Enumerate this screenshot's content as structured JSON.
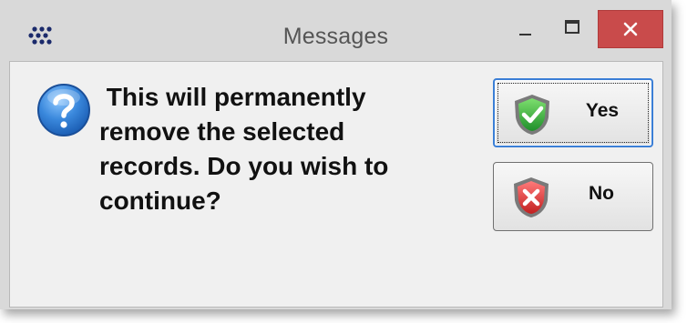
{
  "window": {
    "title": "Messages",
    "app_icon": "app-dots-icon",
    "controls": {
      "minimize_icon": "minimize-icon",
      "maximize_icon": "maximize-icon",
      "close_icon": "close-icon"
    }
  },
  "dialog": {
    "icon": "question-icon",
    "message": " This will permanently\nremove the selected\nrecords. Do you wish to\ncontinue?"
  },
  "buttons": {
    "yes": {
      "label": "Yes",
      "icon": "green-check-shield-icon"
    },
    "no": {
      "label": "No",
      "icon": "red-x-shield-icon"
    }
  },
  "colors": {
    "close_button": "#c94b4b",
    "focus_border": "#3b7fd6",
    "question_icon": "#2f7fd8"
  }
}
